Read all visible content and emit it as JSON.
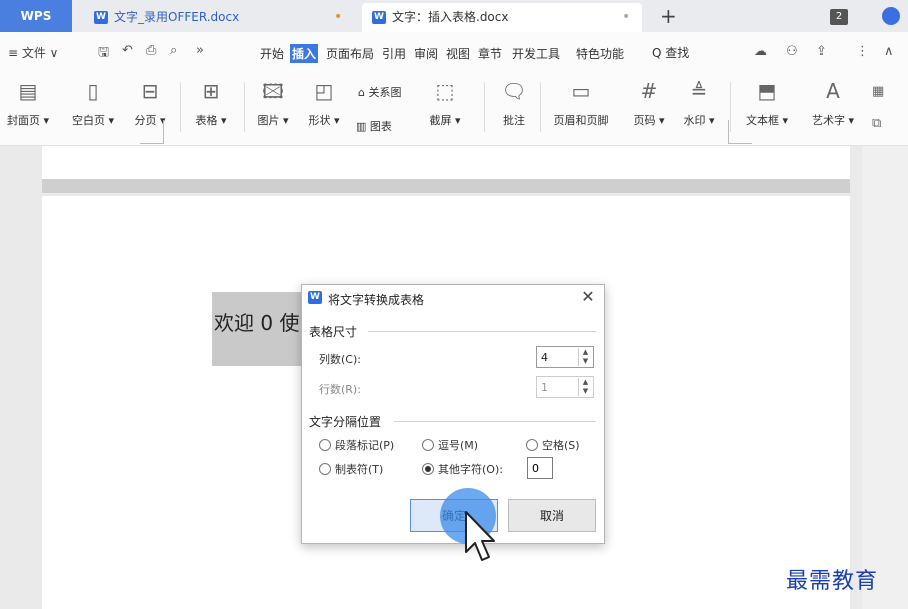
{
  "tabbar": {
    "app": "WPS",
    "tabs": [
      {
        "label": "文字_录用OFFER.docx",
        "modified_dot": "•"
      },
      {
        "label": "文字：插入表格.docx",
        "modified_dot": "•"
      }
    ],
    "badge": "2"
  },
  "menubar": {
    "file": "≡ 文件 ∨",
    "more": "»",
    "items": [
      "开始",
      "插入",
      "页面布局",
      "引用",
      "审阅",
      "视图",
      "章节",
      "开发工具",
      "特色功能"
    ],
    "active_index": 1,
    "search": "Q 查找"
  },
  "ribbon": {
    "items": [
      "封面页 ▾",
      "空白页 ▾",
      "分页 ▾",
      "表格 ▾",
      "图片 ▾",
      "形状 ▾",
      "关系图",
      "图表",
      "截屏 ▾",
      "批注",
      "页眉和页脚",
      "页码 ▾",
      "水印 ▾",
      "文本框 ▾",
      "艺术字 ▾"
    ]
  },
  "document": {
    "selected_text": "欢迎 0 使"
  },
  "dialog": {
    "title": "将文字转换成表格",
    "size_group": "表格尺寸",
    "columns_label": "列数(C):",
    "columns_value": "4",
    "rows_label": "行数(R):",
    "rows_value": "1",
    "separator_group": "文字分隔位置",
    "options": [
      "段落标记(P)",
      "逗号(M)",
      "空格(S)",
      "制表符(T)",
      "其他字符(O):"
    ],
    "checked_option": 4,
    "other_value": "0",
    "ok_label": "确定",
    "cancel_label": "取消"
  },
  "watermark": "最需教育",
  "colors": {
    "accent": "#3c78e0",
    "watermark": "#1a3fb0",
    "click_halo": "#3c8ceb"
  }
}
